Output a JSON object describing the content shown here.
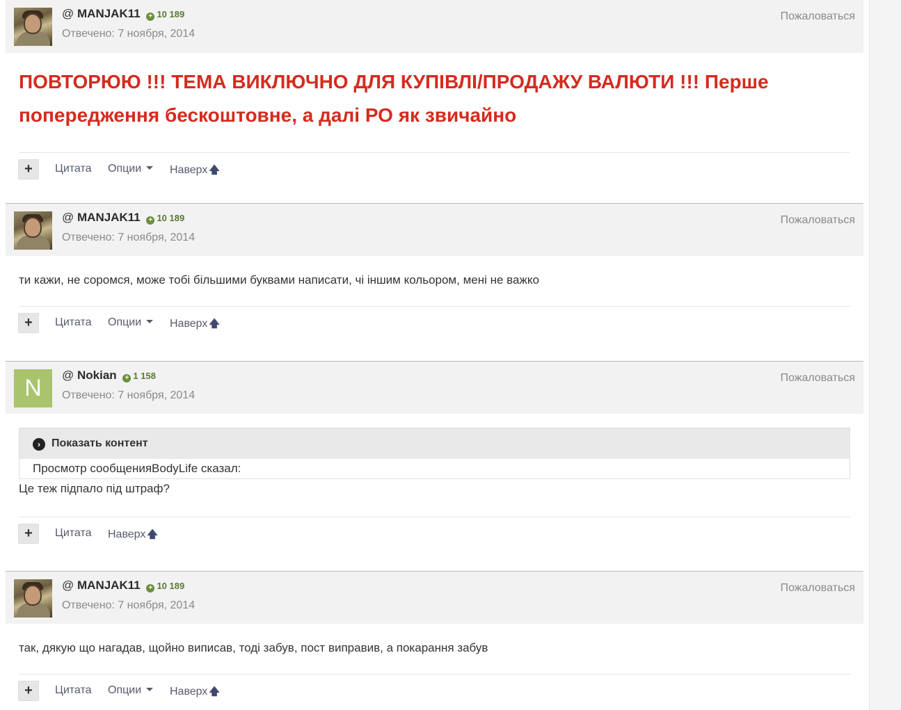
{
  "common": {
    "report_label": "Пожаловаться",
    "quote_label": "Цитата",
    "options_label": "Опции",
    "top_label": "Наверх",
    "plus_label": "+",
    "up_arrow": "🡅",
    "at": "@",
    "rep_icon": "+"
  },
  "posts": [
    {
      "author": "MANJAK11",
      "reputation": "10 189",
      "date": "Отвечено: 7 ноября, 2014",
      "avatar": "photo",
      "text": "ПОВТОРЮЮ !!! ТЕМА ВИКЛЮЧНО ДЛЯ КУПІВЛІ/ПРОДАЖУ ВАЛЮТИ !!! Перше попередження бескоштовне, а далі РО як звичайно"
    },
    {
      "author": "MANJAK11",
      "reputation": "10 189",
      "date": "Отвечено: 7 ноября, 2014",
      "avatar": "photo",
      "text": "ти кажи, не соромся, може тобі більшими буквами написати, чі іншим кольором, мені не важко"
    },
    {
      "author": "Nokian",
      "reputation": "1 158",
      "date": "Отвечено: 7 ноября, 2014",
      "avatar_letter": "N",
      "spoiler": {
        "title": "Показать контент",
        "content": "Просмотр сообщенияBodyLife сказал:"
      },
      "text": "Це теж підпало під штраф?"
    },
    {
      "author": "MANJAK11",
      "reputation": "10 189",
      "date": "Отвечено: 7 ноября, 2014",
      "avatar": "photo",
      "text": "так, дякую що нагадав, щойно виписав, тоді забув, пост виправив, а покарання забув"
    }
  ],
  "colors": {
    "warning_text": "#d52b1e",
    "reputation": "#5a7a32",
    "header_bg": "#f2f2f2",
    "letter_avatar_bg": "#a9c46c"
  }
}
